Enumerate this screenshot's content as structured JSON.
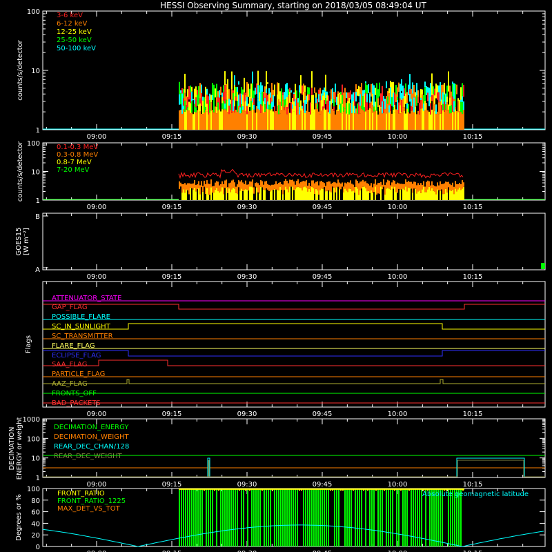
{
  "title": "HESSI Observing Summary, starting on 2018/03/05 08:49:04 UT",
  "time_ticks": [
    "09:00",
    "09:15",
    "09:30",
    "09:45",
    "10:00",
    "10:15"
  ],
  "colors": {
    "axes": "#ffffff",
    "band1": "#ff2020",
    "band2": "#ff8000",
    "band3": "#ffff00",
    "band4": "#00ff00",
    "band5": "#00ffff"
  },
  "chart_data": [
    {
      "id": "lightcurve-low",
      "type": "line",
      "ylabel": "counts/s/detector",
      "yscale": "log",
      "ylim": [
        1,
        100
      ],
      "yticks": [
        "1",
        "10",
        "100"
      ],
      "time_range": [
        "08:49:04",
        "10:29:04"
      ],
      "data_window": [
        "09:17",
        "10:13"
      ],
      "series": [
        {
          "name": "3-6 keV",
          "color": "#ff2020"
        },
        {
          "name": "6-12 keV",
          "color": "#ff8000"
        },
        {
          "name": "12-25 keV",
          "color": "#ffff00"
        },
        {
          "name": "25-50 keV",
          "color": "#00ff00"
        },
        {
          "name": "50-100 keV",
          "color": "#00ffff"
        }
      ]
    },
    {
      "id": "lightcurve-high",
      "type": "line",
      "ylabel": "counts/s/detector",
      "yscale": "log",
      "ylim": [
        1,
        100
      ],
      "yticks": [
        "1",
        "10",
        "100"
      ],
      "series": [
        {
          "name": "0.1-0.3 MeV",
          "color": "#ff2020"
        },
        {
          "name": "0.3-0.8 MeV",
          "color": "#ff8000"
        },
        {
          "name": "0.8-7 MeV",
          "color": "#ffff00"
        },
        {
          "name": "7-20 MeV",
          "color": "#00ff00"
        }
      ]
    },
    {
      "id": "goes",
      "type": "line",
      "ylabel": "GOES15",
      "ylabel2": "[W m⁻²]",
      "yticks": [
        "A",
        "B"
      ]
    },
    {
      "id": "flags",
      "type": "line",
      "ylabel": "Flags",
      "series": [
        {
          "name": "ATTENUATOR_STATE",
          "color": "#ff00ff"
        },
        {
          "name": "GAP_FLAG",
          "color": "#ff3030"
        },
        {
          "name": "POSSIBLE_FLARE",
          "color": "#00ffff"
        },
        {
          "name": "SC_IN_SUNLIGHT",
          "color": "#ffff00"
        },
        {
          "name": "SC_TRANSMITTER",
          "color": "#ff8000"
        },
        {
          "name": "FLARE_FLAG",
          "color": "#ffff60"
        },
        {
          "name": "ECLIPSE_FLAG",
          "color": "#3030ff"
        },
        {
          "name": "SAA_FLAG",
          "color": "#ff3030"
        },
        {
          "name": "PARTICLE_FLAG",
          "color": "#ff8000"
        },
        {
          "name": "AAZ_FLAG",
          "color": "#b0b030"
        },
        {
          "name": "FRONTS_OFF",
          "color": "#00ff00"
        },
        {
          "name": "BAD_PACKETS",
          "color": "#ff3030"
        }
      ]
    },
    {
      "id": "decimation",
      "type": "line",
      "ylabel": "DECIMATION",
      "ylabel2": "ENERGY or weight",
      "yscale": "log",
      "ylim": [
        1,
        1000
      ],
      "yticks": [
        "1",
        "10",
        "100",
        "1000"
      ],
      "series": [
        {
          "name": "DECIMATION_ENERGY",
          "color": "#00ff00"
        },
        {
          "name": "DECIMATION_WEIGHT",
          "color": "#ff8000"
        },
        {
          "name": "REAR_DEC_CHAN/128",
          "color": "#00ffff"
        },
        {
          "name": "REAR_DEC_WEIGHT",
          "color": "#808040"
        }
      ]
    },
    {
      "id": "ratios",
      "type": "line",
      "ylabel": "Degrees or %",
      "ylim": [
        0,
        100
      ],
      "yticks": [
        "0",
        "20",
        "40",
        "60",
        "80",
        "100"
      ],
      "annotation": "Absolute geomagnetic latitude",
      "series": [
        {
          "name": "FRONT_RATIO",
          "color": "#ffff00"
        },
        {
          "name": "FRONT_RATIO_1225",
          "color": "#00ff00"
        },
        {
          "name": "MAX_DET_VS_TOT",
          "color": "#ff8000"
        }
      ]
    }
  ]
}
